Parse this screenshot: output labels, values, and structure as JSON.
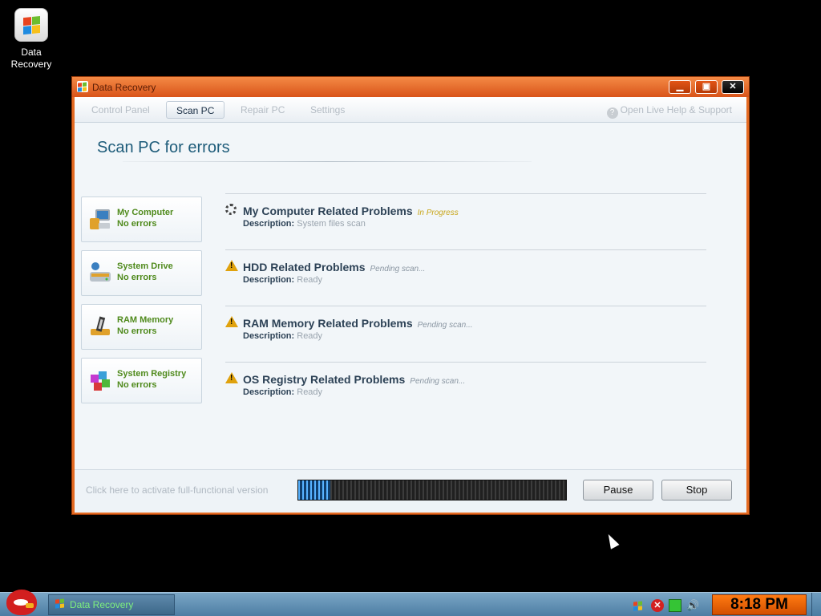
{
  "desktop": {
    "icon_label": "Data Recovery"
  },
  "window": {
    "title": "Data Recovery",
    "controls": {
      "minimize": "minimize-icon",
      "maximize": "maximize-icon",
      "close": "close-icon"
    }
  },
  "nav": {
    "tabs": [
      "Control Panel",
      "Scan PC",
      "Repair PC",
      "Settings"
    ],
    "active_tab": "Scan PC",
    "help_label": "Open Live Help & Support"
  },
  "main": {
    "heading": "Scan PC for errors",
    "cards": [
      {
        "title": "My Computer",
        "status": "No errors",
        "icon": "computer-icon"
      },
      {
        "title": "System Drive",
        "status": "No errors",
        "icon": "drive-icon"
      },
      {
        "title": "RAM Memory",
        "status": "No errors",
        "icon": "ram-icon"
      },
      {
        "title": "System Registry",
        "status": "No errors",
        "icon": "registry-icon"
      }
    ],
    "problems": [
      {
        "title": "My Computer Related Problems",
        "status": "In Progress",
        "desc_label": "Description:",
        "desc": "System files scan",
        "icon": "spinner-icon"
      },
      {
        "title": "HDD Related Problems",
        "status": "Pending scan...",
        "desc_label": "Description:",
        "desc": "Ready",
        "icon": "warning-icon"
      },
      {
        "title": "RAM Memory Related Problems",
        "status": "Pending scan...",
        "desc_label": "Description:",
        "desc": "Ready",
        "icon": "warning-icon"
      },
      {
        "title": "OS Registry Related Problems",
        "status": "Pending scan...",
        "desc_label": "Description:",
        "desc": "Ready",
        "icon": "warning-icon"
      }
    ]
  },
  "footer": {
    "activate_text": "Click here to activate full-functional version",
    "progress": 0.12,
    "pause_label": "Pause",
    "stop_label": "Stop"
  },
  "taskbar": {
    "task_label": "Data Recovery",
    "clock": "8:18 PM"
  },
  "colors": {
    "window_frame": "#e46a22",
    "card_text": "#4f8a1c",
    "heading": "#1e5c7a",
    "in_progress": "#c8a61a",
    "clock_bg": "#ff7a12"
  }
}
